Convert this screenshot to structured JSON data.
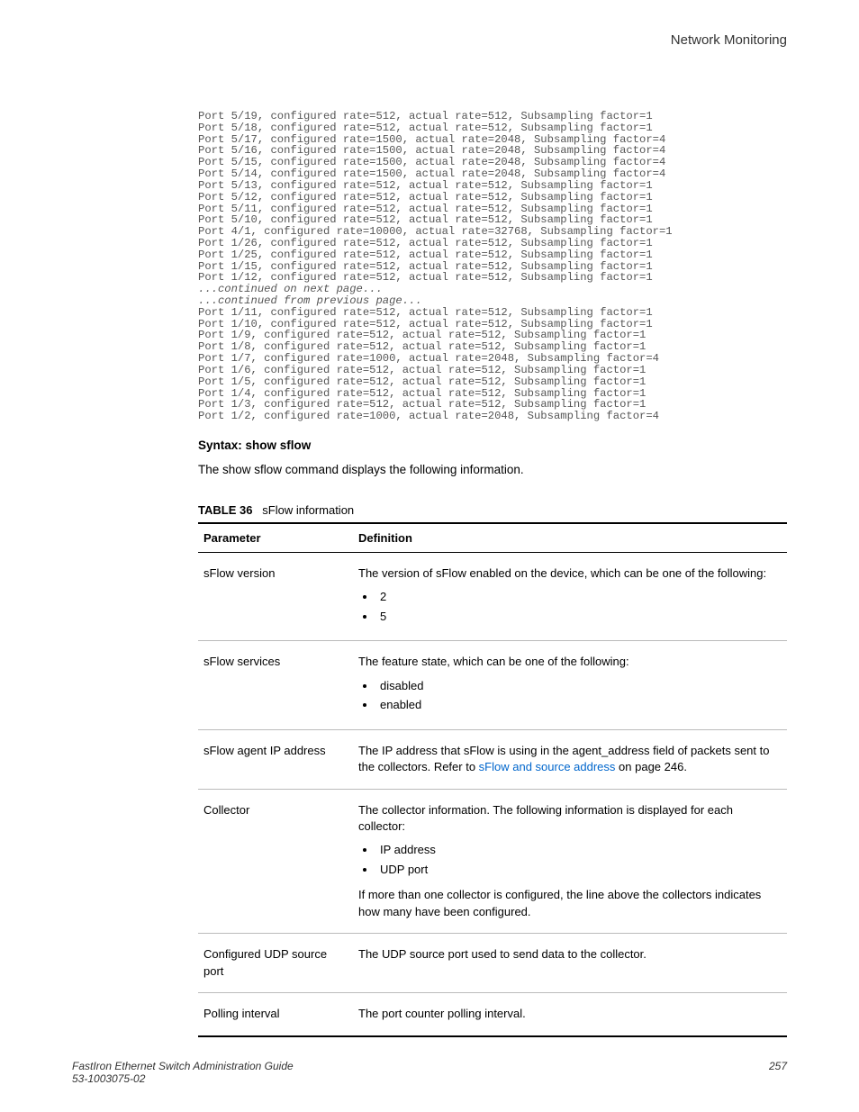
{
  "header": {
    "running": "Network Monitoring"
  },
  "code": {
    "lines": [
      "Port 5/19, configured rate=512, actual rate=512, Subsampling factor=1",
      "Port 5/18, configured rate=512, actual rate=512, Subsampling factor=1",
      "Port 5/17, configured rate=1500, actual rate=2048, Subsampling factor=4",
      "Port 5/16, configured rate=1500, actual rate=2048, Subsampling factor=4",
      "Port 5/15, configured rate=1500, actual rate=2048, Subsampling factor=4",
      "Port 5/14, configured rate=1500, actual rate=2048, Subsampling factor=4",
      "Port 5/13, configured rate=512, actual rate=512, Subsampling factor=1",
      "Port 5/12, configured rate=512, actual rate=512, Subsampling factor=1",
      "Port 5/11, configured rate=512, actual rate=512, Subsampling factor=1",
      "Port 5/10, configured rate=512, actual rate=512, Subsampling factor=1",
      "Port 4/1, configured rate=10000, actual rate=32768, Subsampling factor=1",
      "Port 1/26, configured rate=512, actual rate=512, Subsampling factor=1",
      "Port 1/25, configured rate=512, actual rate=512, Subsampling factor=1",
      "Port 1/15, configured rate=512, actual rate=512, Subsampling factor=1",
      "Port 1/12, configured rate=512, actual rate=512, Subsampling factor=1"
    ],
    "cont_next": "...continued on next page...",
    "cont_prev": "...continued from previous page...",
    "lines2": [
      "Port 1/11, configured rate=512, actual rate=512, Subsampling factor=1",
      "Port 1/10, configured rate=512, actual rate=512, Subsampling factor=1",
      "Port 1/9, configured rate=512, actual rate=512, Subsampling factor=1",
      "Port 1/8, configured rate=512, actual rate=512, Subsampling factor=1",
      "Port 1/7, configured rate=1000, actual rate=2048, Subsampling factor=4",
      "Port 1/6, configured rate=512, actual rate=512, Subsampling factor=1",
      "Port 1/5, configured rate=512, actual rate=512, Subsampling factor=1",
      "Port 1/4, configured rate=512, actual rate=512, Subsampling factor=1",
      "Port 1/3, configured rate=512, actual rate=512, Subsampling factor=1",
      "Port 1/2, configured rate=1000, actual rate=2048, Subsampling factor=4"
    ]
  },
  "syntax": "Syntax: show sflow",
  "intro": "The show sflow command displays the following information.",
  "table": {
    "caption_label": "TABLE 36",
    "caption_title": "sFlow information",
    "head": {
      "param": "Parameter",
      "def": "Definition"
    },
    "rows": {
      "r0": {
        "param": "sFlow version",
        "def": "The version of sFlow enabled on the device, which can be one of the following:",
        "b1": "2",
        "b2": "5"
      },
      "r1": {
        "param": "sFlow services",
        "def": "The feature state, which can be one of the following:",
        "b1": "disabled",
        "b2": "enabled"
      },
      "r2": {
        "param": "sFlow agent IP address",
        "def_pre": "The IP address that sFlow is using in the agent_address field of packets sent to the collectors. Refer to ",
        "link": "sFlow and source address",
        "def_post": " on page 246."
      },
      "r3": {
        "param": "Collector",
        "def": "The collector information. The following information is displayed for each collector:",
        "b1": "IP address",
        "b2": "UDP port",
        "after": "If more than one collector is configured, the line above the collectors indicates how many have been configured."
      },
      "r4": {
        "param": "Configured UDP source port",
        "def": "The UDP source port used to send data to the collector."
      },
      "r5": {
        "param": "Polling interval",
        "def": "The port counter polling interval."
      }
    }
  },
  "footer": {
    "title": "FastIron Ethernet Switch Administration Guide",
    "docnum": "53-1003075-02",
    "page": "257"
  }
}
